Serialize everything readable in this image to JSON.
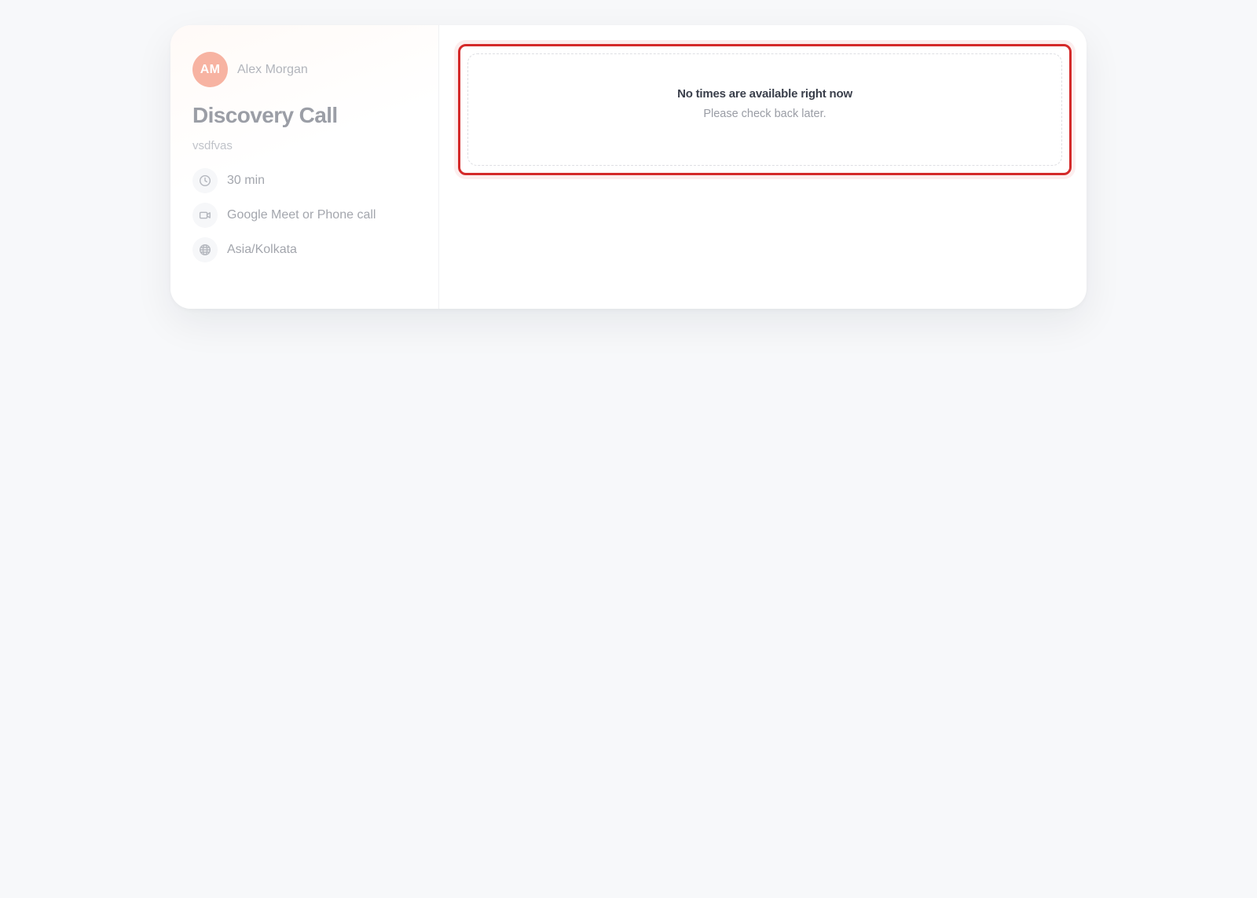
{
  "host": {
    "initials": "AM",
    "name": "Alex Morgan",
    "avatar_color": "#f7b3a2"
  },
  "event": {
    "title": "Discovery Call",
    "description": "vsdfvas",
    "details": [
      {
        "icon": "clock-icon",
        "label": "30 min"
      },
      {
        "icon": "video-camera-icon",
        "label": "Google Meet or Phone call"
      },
      {
        "icon": "globe-icon",
        "label": "Asia/Kolkata"
      }
    ]
  },
  "availability": {
    "empty_title": "No times are available right now",
    "empty_subtitle": "Please check back later.",
    "highlight_color": "#d42a2a"
  }
}
